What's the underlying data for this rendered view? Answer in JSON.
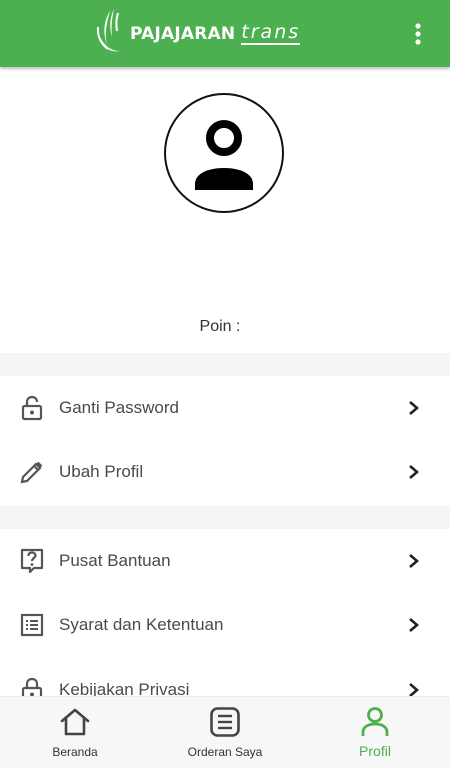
{
  "app": {
    "brand": "PAJAJARAN",
    "brand_suffix": "trans",
    "accent_color": "#4caf50"
  },
  "profile": {
    "poin_label": "Poin :",
    "avatar_icon": "person-icon"
  },
  "menu": [
    {
      "label": "Ganti Password",
      "icon": "lock-open-icon"
    },
    {
      "label": "Ubah Profil",
      "icon": "pencil-icon"
    },
    {
      "label": "Pusat Bantuan",
      "icon": "help-icon"
    },
    {
      "label": "Syarat dan Ketentuan",
      "icon": "list-icon"
    },
    {
      "label": "Kebijakan Privasi",
      "icon": "lock-icon"
    }
  ],
  "bottom_nav": [
    {
      "label": "Beranda",
      "icon": "home-icon",
      "active": false
    },
    {
      "label": "Orderan Saya",
      "icon": "orders-icon",
      "active": false
    },
    {
      "label": "Profil",
      "icon": "person-icon",
      "active": true
    }
  ]
}
